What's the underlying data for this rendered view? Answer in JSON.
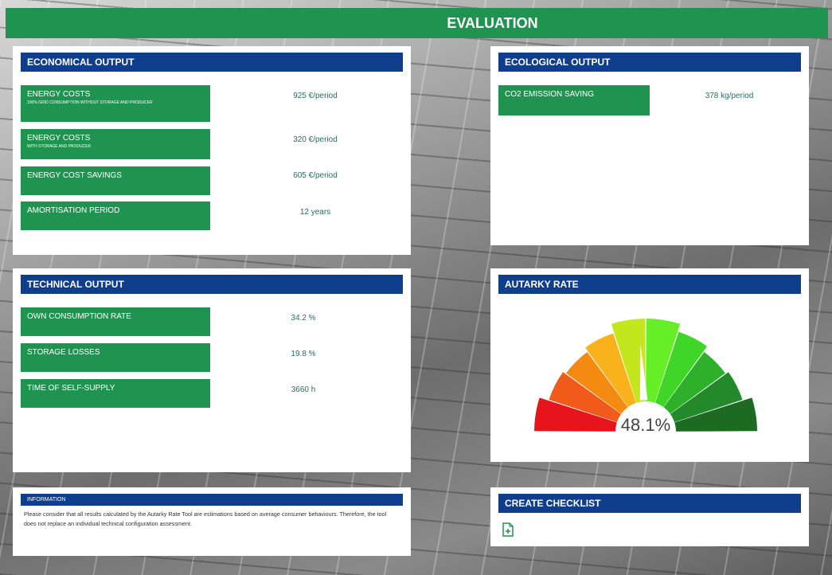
{
  "header": {
    "title": "EVALUATION"
  },
  "economical": {
    "title": "ECONOMICAL OUTPUT",
    "rows": [
      {
        "label": "ENERGY COSTS",
        "sub": "100% GRID CONSUMPTION WITHOUT STORAGE AND PRODUCER",
        "value": "925 €/period"
      },
      {
        "label": "ENERGY COSTS",
        "sub": "WITH STORAGE AND PRODUCER",
        "value": "320 €/period"
      },
      {
        "label": "ENERGY COST SAVINGS",
        "value": "605 €/period"
      },
      {
        "label": "AMORTISATION PERIOD",
        "value": "12 years"
      }
    ]
  },
  "ecological": {
    "title": "ECOLOGICAL OUTPUT",
    "rows": [
      {
        "label": "CO2 EMISSION SAVING",
        "value": "378 kg/period"
      }
    ]
  },
  "technical": {
    "title": "TECHNICAL OUTPUT",
    "rows": [
      {
        "label": "OWN CONSUMPTION RATE",
        "value": "34.2 %"
      },
      {
        "label": "STORAGE LOSSES",
        "value": "19.8 %"
      },
      {
        "label": "TIME OF SELF-SUPPLY",
        "value": "3660 h"
      }
    ]
  },
  "autarky": {
    "title": "AUTARKY RATE",
    "value_text": "48.1%",
    "value": 48.1,
    "segment_colors": [
      "#e8141b",
      "#f05b1b",
      "#f58a12",
      "#f9b21b",
      "#c4e61c",
      "#66ef26",
      "#3fd628",
      "#2fb02a",
      "#23892a",
      "#1d6b22"
    ]
  },
  "information": {
    "title": "INFORMATION",
    "text": "Please consider that all results calculated by the Autarky Rate Tool are estimations based on average consumer behaviours. Therefore, the tool does not replace an individual technical configuration assessment."
  },
  "checklist": {
    "title": "CREATE CHECKLIST",
    "icon": "document-add-icon"
  },
  "colors": {
    "brand_green": "#1e9450",
    "brand_blue": "#0f3f8c",
    "value_text": "#2a6b63"
  }
}
